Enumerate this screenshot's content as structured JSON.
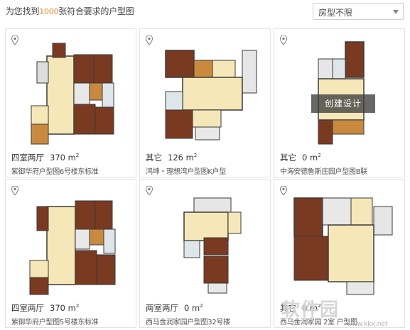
{
  "header": {
    "prefix": "为您找到",
    "count": "1000",
    "suffix": "张符合要求的户型图",
    "filter_label": "房型不限"
  },
  "cards": [
    {
      "type": "四室两厅",
      "area": "370 m",
      "name": "紫御华府户型图6号楼东标准"
    },
    {
      "type": "其它",
      "area": "126 m",
      "name": "鸿坤・理想湾户型图K户型"
    },
    {
      "type": "其它",
      "area": "0 m",
      "name": "中海安德鲁斯庄园户型图B联",
      "overlay": "创建设计"
    },
    {
      "type": "四室两厅",
      "area": "370 m",
      "name": "紫御华府户型图5号楼东标准"
    },
    {
      "type": "两室两厅",
      "area": "0 m",
      "name": "西马金润家园户型图32号楼"
    },
    {
      "type": "其它",
      "area": "0 m",
      "name": "西马金润家园 2室 户型图"
    }
  ],
  "watermark": {
    "text": "软件园",
    "url": "www.kkx.net"
  },
  "colors": {
    "accent": "#f08a24",
    "wall": "#3a3a3a",
    "wood_dark": "#7a3a22",
    "wood_light": "#c98a3e",
    "floor_light": "#f6e7b8"
  }
}
